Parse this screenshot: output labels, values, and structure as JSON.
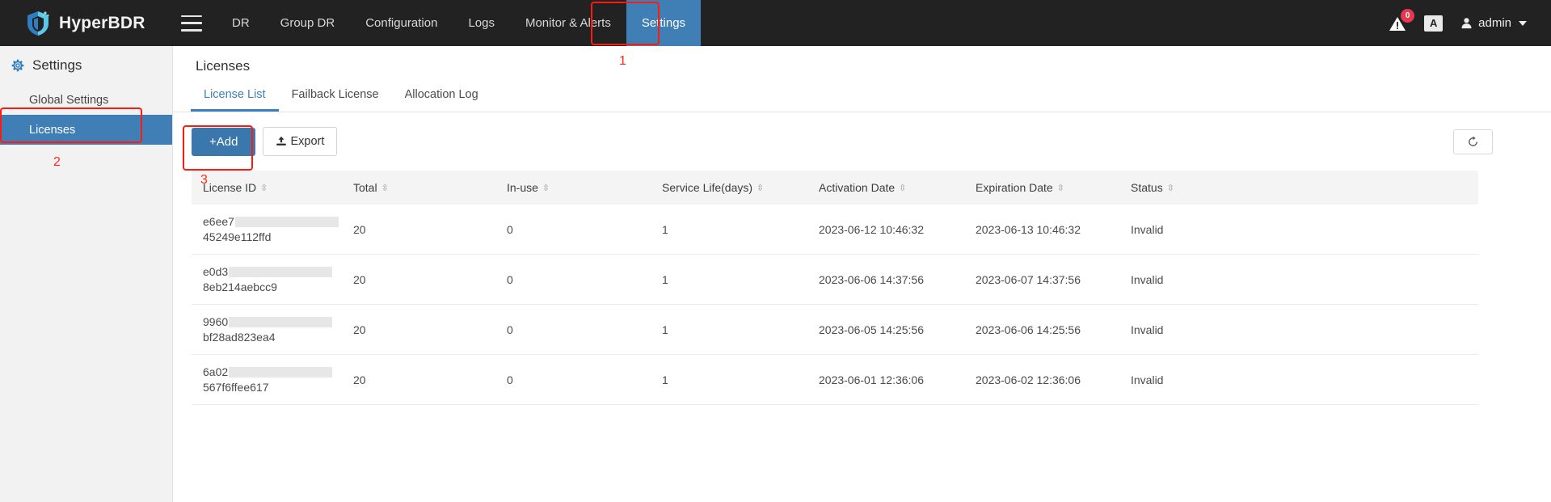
{
  "header": {
    "brand": "HyperBDR",
    "menu_icon": "hamburger-icon",
    "nav": [
      {
        "label": "DR",
        "active": false
      },
      {
        "label": "Group DR",
        "active": false
      },
      {
        "label": "Configuration",
        "active": false
      },
      {
        "label": "Logs",
        "active": false
      },
      {
        "label": "Monitor & Alerts",
        "active": false
      },
      {
        "label": "Settings",
        "active": true
      }
    ],
    "alert_icon": "warning-triangle-icon",
    "alert_badge": "0",
    "language_icon": "translate-icon",
    "language_label": "A",
    "user_icon": "user-avatar-icon",
    "user_name": "admin"
  },
  "sidebar": {
    "heading": "Settings",
    "heading_icon": "gear-icon",
    "items": [
      {
        "label": "Global Settings",
        "active": false
      },
      {
        "label": "Licenses",
        "active": true
      }
    ]
  },
  "main": {
    "page_title": "Licenses",
    "tabs": [
      {
        "label": "License List",
        "active": true
      },
      {
        "label": "Failback License",
        "active": false
      },
      {
        "label": "Allocation Log",
        "active": false
      }
    ],
    "toolbar": {
      "add_label": "+Add",
      "export_label": "Export",
      "export_icon": "upload-icon",
      "refresh_icon": "refresh-icon"
    },
    "table": {
      "columns": [
        {
          "label": "License ID",
          "sortable": true
        },
        {
          "label": "Total",
          "sortable": true
        },
        {
          "label": "In-use",
          "sortable": true
        },
        {
          "label": "Service Life(days)",
          "sortable": true
        },
        {
          "label": "Activation Date",
          "sortable": true
        },
        {
          "label": "Expiration Date",
          "sortable": true
        },
        {
          "label": "Status",
          "sortable": true
        }
      ],
      "rows": [
        {
          "license_id_prefix": "e6ee7",
          "license_id_suffix": "45249e112ffd",
          "total": "20",
          "in_use": "0",
          "service_life": "1",
          "activation_date": "2023-06-12 10:46:32",
          "expiration_date": "2023-06-13 10:46:32",
          "status": "Invalid"
        },
        {
          "license_id_prefix": "e0d3",
          "license_id_suffix": "8eb214aebcc9",
          "total": "20",
          "in_use": "0",
          "service_life": "1",
          "activation_date": "2023-06-06 14:37:56",
          "expiration_date": "2023-06-07 14:37:56",
          "status": "Invalid"
        },
        {
          "license_id_prefix": "9960",
          "license_id_suffix": "bf28ad823ea4",
          "total": "20",
          "in_use": "0",
          "service_life": "1",
          "activation_date": "2023-06-05 14:25:56",
          "expiration_date": "2023-06-06 14:25:56",
          "status": "Invalid"
        },
        {
          "license_id_prefix": "6a02",
          "license_id_suffix": "567f6ffee617",
          "total": "20",
          "in_use": "0",
          "service_life": "1",
          "activation_date": "2023-06-01 12:36:06",
          "expiration_date": "2023-06-02 12:36:06",
          "status": "Invalid"
        }
      ]
    }
  },
  "annotations": {
    "color": "#ff2a17",
    "steps": [
      {
        "number": "1",
        "target": "settings-nav-tab"
      },
      {
        "number": "2",
        "target": "sidebar-item-licenses"
      },
      {
        "number": "3",
        "target": "add-button"
      }
    ]
  },
  "colors": {
    "topbar_bg": "#222222",
    "accent_blue": "#3a77ad",
    "sidebar_bg": "#f2f2f2",
    "badge_red": "#e8384f",
    "annotation_red": "#ff2a17"
  }
}
